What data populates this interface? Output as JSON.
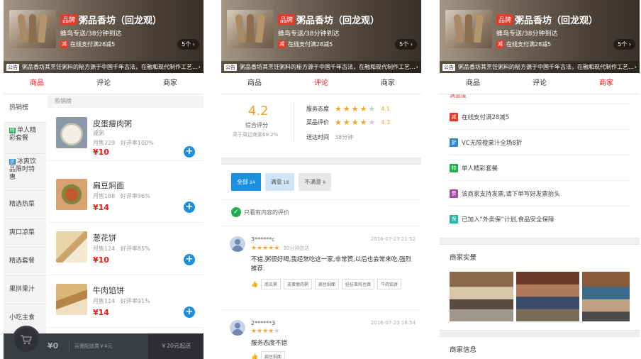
{
  "shop": {
    "brand_badge": "品牌",
    "name": "粥品香坊（回龙观）",
    "delivery": "蜂鸟专送/38分钟到达",
    "pay_tag": "减",
    "pay_text": "在线支付满28减5",
    "more": "5个 ›",
    "notice_tag": "公告",
    "notice_text": "粥品香坊其烹饪粥料的秘方源于中国千年古法，在融和现代制作工艺…",
    "notice_arrow": "›"
  },
  "tabs": [
    "商品",
    "评论",
    "商家"
  ],
  "panel1": {
    "category_header": "热销榜",
    "menu": [
      {
        "label": "热销榜",
        "tag": ""
      },
      {
        "label": "单人精彩套餐",
        "tag": "特"
      },
      {
        "label": "冰爽饮品限时特惠",
        "tag": "折"
      },
      {
        "label": "精选热菜",
        "tag": ""
      },
      {
        "label": "爽口凉菜",
        "tag": ""
      },
      {
        "label": "精选套餐",
        "tag": ""
      },
      {
        "label": "果拼果汁",
        "tag": ""
      },
      {
        "label": "小吃主食",
        "tag": ""
      }
    ],
    "foods": [
      {
        "name": "皮蛋瘦肉粥",
        "desc": "咸粥",
        "sales": "月售229",
        "rating": "好评率100%",
        "price": "¥10"
      },
      {
        "name": "扁豆焖面",
        "desc": "",
        "sales": "月售188",
        "rating": "好评率96%",
        "price": "¥14"
      },
      {
        "name": "葱花饼",
        "desc": "",
        "sales": "月售124",
        "rating": "好评率85%",
        "price": "¥10"
      },
      {
        "name": "牛肉馅饼",
        "desc": "",
        "sales": "月售114",
        "rating": "好评率91%",
        "price": "¥14"
      }
    ],
    "add_icon": "+",
    "cart": {
      "price": "¥0",
      "fee": "另需配送费￥4元",
      "min": "￥20元起送"
    }
  },
  "panel2": {
    "score": "4.2",
    "score_label": "综合评分",
    "score_compare": "高于周边商家69.2%",
    "service_label": "服务态度",
    "service_value": "4.1",
    "service_stars": 4,
    "food_label": "菜品评价",
    "food_value": "4.3",
    "food_stars": 4,
    "time_label": "送达时间",
    "time_value": "38分钟",
    "filter_all": "全部",
    "filter_all_count": "24",
    "filter_good": "满意",
    "filter_good_count": "18",
    "filter_bad": "不满意",
    "filter_bad_count": "6",
    "check_icon": "✓",
    "only_content": "只看有内容的评价",
    "reviews": [
      {
        "user": "3******c",
        "time": "2016-07-23 21:52",
        "stars": 5,
        "speed": "30分钟送达",
        "text": "不错,粥很好喝,我经常吃这一家,非常赞,以后也会常来吃,强烈推荐.",
        "tags": [
          "南瓜粥",
          "皮蛋瘦肉粥",
          "扁豆焖面",
          "娃娃菜炖豆腐",
          "牛肉馅饼"
        ]
      },
      {
        "user": "2******3",
        "time": "2016-07-23 18:54",
        "stars": 4,
        "speed": "",
        "text": "服务态度不错",
        "tags": [
          "扁豆焖面"
        ]
      }
    ]
  },
  "panel3": {
    "partial_text": "满意度",
    "items": [
      {
        "icon": "减",
        "color": "#e23b2e",
        "text": "在线支付满28减5"
      },
      {
        "icon": "折",
        "color": "#2a8ad8",
        "text": "VC无限橙果汁全场8折"
      },
      {
        "icon": "特",
        "color": "#1fae4e",
        "text": "单人精彩套餐"
      },
      {
        "icon": "票",
        "color": "#a349a4",
        "text": "该商家支持发票,请下单写好发票抬头"
      },
      {
        "icon": "保",
        "color": "#27b2a4",
        "text": "已加入“外卖保”计划,食品安全保障"
      }
    ],
    "photos_title": "商家实景",
    "info_title": "商家信息"
  }
}
